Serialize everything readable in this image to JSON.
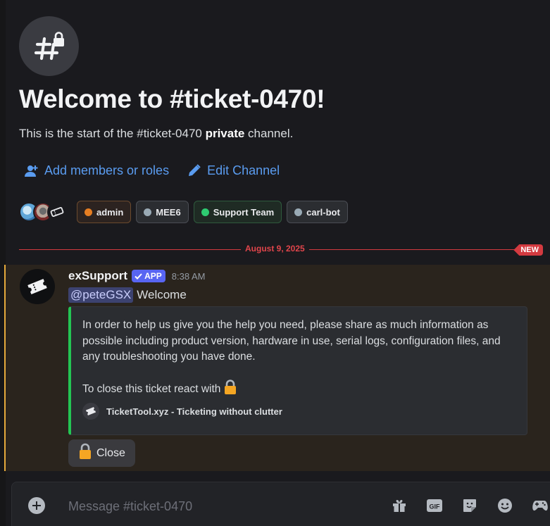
{
  "channel": {
    "title": "Welcome to #ticket-0470!",
    "intro_prefix": "This is the start of the #ticket-0470 ",
    "intro_bold": "private",
    "intro_suffix": " channel."
  },
  "actions": {
    "add_members": "Add members or roles",
    "edit_channel": "Edit Channel"
  },
  "roles": [
    {
      "label": "admin",
      "color": "#e67e22"
    },
    {
      "label": "MEE6",
      "color": "#99aab5"
    },
    {
      "label": "Support Team",
      "color": "#2ecc71"
    },
    {
      "label": "carl-bot",
      "color": "#99aab5"
    }
  ],
  "divider": {
    "date": "August 9, 2025",
    "badge": "NEW"
  },
  "message": {
    "username": "exSupport",
    "app_tag": "APP",
    "timestamp": "8:38 AM",
    "mention": "@peteGSX",
    "text": "Welcome",
    "embed": {
      "description": "In order to help us give you the help you need, please share as much information as possible including product version, hardware in use, serial logs, configuration files, and any troubleshooting you have done.",
      "close_text": "To close this ticket react with",
      "footer": "TicketTool.xyz - Ticketing without clutter",
      "accent_color": "#23c553"
    },
    "button_label": "Close"
  },
  "composer": {
    "placeholder": "Message #ticket-0470",
    "icons": [
      "gift-icon",
      "gif-icon",
      "sticker-icon",
      "emoji-icon",
      "game-controller-icon"
    ]
  }
}
